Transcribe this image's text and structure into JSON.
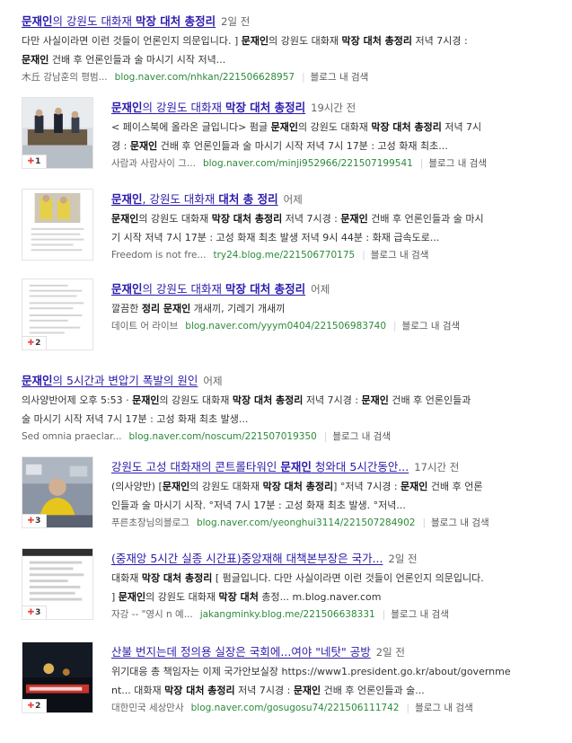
{
  "results": [
    {
      "title_parts": [
        [
          "문재인",
          1
        ],
        [
          "의 강원도 대화재 ",
          0
        ],
        [
          "막장 대처 총정리",
          1
        ]
      ],
      "date": "2일 전",
      "lines": [
        [
          [
            "다만 사실이라면 이런 것들이 언론인지 의문입니다. ] ",
            0
          ],
          [
            "문재인",
            1
          ],
          [
            "의 강원도 대화재 ",
            0
          ],
          [
            "막장 대처 총정리",
            1
          ],
          [
            " 저녁 7시경 :",
            0
          ]
        ],
        [
          [
            "문재인",
            1
          ],
          [
            " 건배 후 언론인들과 술 마시기 시작 저녁...",
            0
          ]
        ]
      ],
      "author": "木丘 강남훈의 평범...",
      "url": "blog.naver.com/nhkan/221506628957",
      "blog_search": "블로그 내 검색",
      "thumb": null
    },
    {
      "title_parts": [
        [
          "문재인",
          1
        ],
        [
          "의 강원도 대화재 ",
          0
        ],
        [
          "막장 대처 총정리",
          1
        ]
      ],
      "date": "19시간 전",
      "lines": [
        [
          [
            "< 페이스북에 올라온 글입니다> 펌글 ",
            0
          ],
          [
            "문재인",
            1
          ],
          [
            "의 강원도 대화재 ",
            0
          ],
          [
            "막장 대처 총정리",
            1
          ],
          [
            " 저녁 7시",
            0
          ]
        ],
        [
          [
            "경 : ",
            0
          ],
          [
            "문재인",
            1
          ],
          [
            " 건배 후 언론인들과 술 마시기 시작 저녁 7시 17분 : 고성 화재 최초...",
            0
          ]
        ]
      ],
      "author": "사람과 사람사이 그...",
      "url": "blog.naver.com/minji952966/221507199541",
      "blog_search": "블로그 내 검색",
      "thumb": {
        "kind": "photo-meeting",
        "count": "1"
      }
    },
    {
      "title_parts": [
        [
          "문재인",
          1
        ],
        [
          ", 강원도 대화재 ",
          0
        ],
        [
          "대처 총 정리",
          1
        ]
      ],
      "date": "어제",
      "lines": [
        [
          [
            "문재인",
            1
          ],
          [
            "의 강원도 대화재 ",
            0
          ],
          [
            "막장 대처 총정리",
            1
          ],
          [
            " 저녁 7시경 : ",
            0
          ],
          [
            "문재인",
            1
          ],
          [
            " 건배 후 언론인들과 술 마시",
            0
          ]
        ],
        [
          [
            "기 시작 저녁 7시 17분 : 고성 화재 최초 발생 저녁 9시 44분 : 화재 급속도로...",
            0
          ]
        ]
      ],
      "author": "Freedom is not fre...",
      "url": "try24.blog.me/221506770175",
      "blog_search": "블로그 내 검색",
      "thumb": {
        "kind": "doc-photo",
        "count": ""
      }
    },
    {
      "title_parts": [
        [
          "문재인",
          1
        ],
        [
          "의 강원도 대화재 ",
          0
        ],
        [
          "막장 대처 총정리",
          1
        ]
      ],
      "date": "어제",
      "lines": [
        [
          [
            "깔끔한 ",
            0
          ],
          [
            "정리 문재인",
            1
          ],
          [
            " 개새끼, 기레기 개새끼",
            0
          ]
        ]
      ],
      "author": "데이트 어 라이브",
      "url": "blog.naver.com/yyym0404/221506983740",
      "blog_search": "블로그 내 검색",
      "thumb": {
        "kind": "doc",
        "count": "2"
      }
    },
    {
      "title_parts": [
        [
          "문재인",
          1
        ],
        [
          "의 5시간과 변압기 폭발의 원인",
          0
        ]
      ],
      "date": "어제",
      "lines": [
        [
          [
            "의사양반어제 오후 5:53 · ",
            0
          ],
          [
            "문재인",
            1
          ],
          [
            "의 강원도 대화재 ",
            0
          ],
          [
            "막장 대처 총정리",
            1
          ],
          [
            " 저녁 7시경 : ",
            0
          ],
          [
            "문재인",
            1
          ],
          [
            " 건배 후 언론인들과",
            0
          ]
        ],
        [
          [
            "술 마시기 시작 저녁 7시 17분 : 고성 화재 최초 발생...",
            0
          ]
        ]
      ],
      "author": "Sed omnia praeclar...",
      "url": "blog.naver.com/noscum/221507019350",
      "blog_search": "블로그 내 검색",
      "thumb": null
    },
    {
      "title_parts": [
        [
          "강원도 고성 대화재의 콘트롤타워인 ",
          0
        ],
        [
          "문재인",
          1
        ],
        [
          " 청와대 5시간동안...",
          0
        ]
      ],
      "date": "17시간 전",
      "lines": [
        [
          [
            "(의사양반) [",
            0
          ],
          [
            "문재인",
            1
          ],
          [
            "의 강원도 대화재 ",
            0
          ],
          [
            "막장 대처 총정리",
            1
          ],
          [
            "] °저녁 7시경 : ",
            0
          ],
          [
            "문재인",
            1
          ],
          [
            " 건배 후 언론",
            0
          ]
        ],
        [
          [
            "인들과 술 마시기 시작. °저녁 7시 17분 : 고성 화재 최초 발생. °저녁...",
            0
          ]
        ]
      ],
      "author": "푸른초장님의블로그",
      "url": "blog.naver.com/yeonghui3114/221507284902",
      "blog_search": "블로그 내 검색",
      "thumb": {
        "kind": "photo-person",
        "count": "3"
      }
    },
    {
      "title_parts": [
        [
          "(중재앙 5시간 실종 시간표)중앙재해 대책본부장은 국가...",
          0
        ]
      ],
      "date": "2일 전",
      "lines": [
        [
          [
            "대화재 ",
            0
          ],
          [
            "막장 대처 총정리",
            1
          ],
          [
            " [ 펌글입니다. 다만 사실이라면 이런 것들이 언론인지 의문입니다.",
            0
          ]
        ],
        [
          [
            "] ",
            0
          ],
          [
            "문재인",
            1
          ],
          [
            "의 강원도 대화재 ",
            0
          ],
          [
            "막장 대처",
            1
          ],
          [
            " 총정... m.blog.naver.com",
            0
          ]
        ]
      ],
      "author": "자강 -- \"영시 n 예...",
      "url": "jakangminky.blog.me/221506638331",
      "blog_search": "블로그 내 검색",
      "thumb": {
        "kind": "doc-phone",
        "count": "3"
      }
    },
    {
      "title_parts": [
        [
          "산불 번지는데 정의용 실장은 국회에...여야 \"네탓\" 공방",
          0
        ]
      ],
      "date": "2일 전",
      "lines": [
        [
          [
            "위기대응 총 책임자는 이제 국가안보실장 https://www1.president.go.kr/about/governme",
            0
          ]
        ],
        [
          [
            "nt... 대화재 ",
            0
          ],
          [
            "막장 대처 총정리",
            1
          ],
          [
            " 저녁 7시경 : ",
            0
          ],
          [
            "문재인",
            1
          ],
          [
            " 건배 후 언론인들과 술...",
            0
          ]
        ]
      ],
      "author": "대한민국 세상만사",
      "url": "blog.naver.com/gosugosu74/221506111742",
      "blog_search": "블로그 내 검색",
      "thumb": {
        "kind": "photo-night",
        "count": "2"
      }
    }
  ]
}
